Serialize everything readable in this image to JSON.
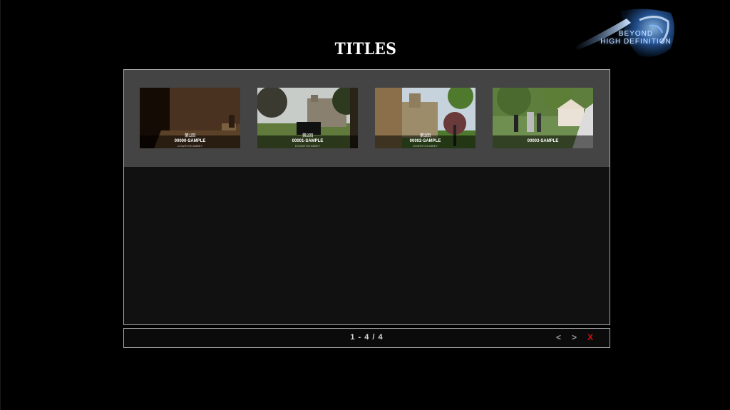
{
  "header": {
    "title": "TITLES",
    "logo_line1": "BEYOND",
    "logo_line2": "HIGH DEFINITION"
  },
  "titles": [
    {
      "label": "00000-SAMPLE",
      "episode": "第1回",
      "subtitle": "DOWNTON ABBEY"
    },
    {
      "label": "00001-SAMPLE",
      "episode": "第2回",
      "subtitle": "DOWNTON ABBEY"
    },
    {
      "label": "00002-SAMPLE",
      "episode": "第3回",
      "subtitle": "DOWNTON ABBEY"
    },
    {
      "label": "00003-SAMPLE",
      "episode": "",
      "subtitle": ""
    }
  ],
  "pager": {
    "count": "1 - 4 / 4",
    "prev_label": "<",
    "next_label": ">",
    "close_label": "X"
  },
  "colors": {
    "background": "#000000",
    "panel_border": "#a9a9a9",
    "thumb_row_bg": "#444444",
    "close_accent": "#d01010"
  },
  "icons": [
    "logo-emblem-icon",
    "prev-arrow-icon",
    "next-arrow-icon",
    "close-icon"
  ]
}
